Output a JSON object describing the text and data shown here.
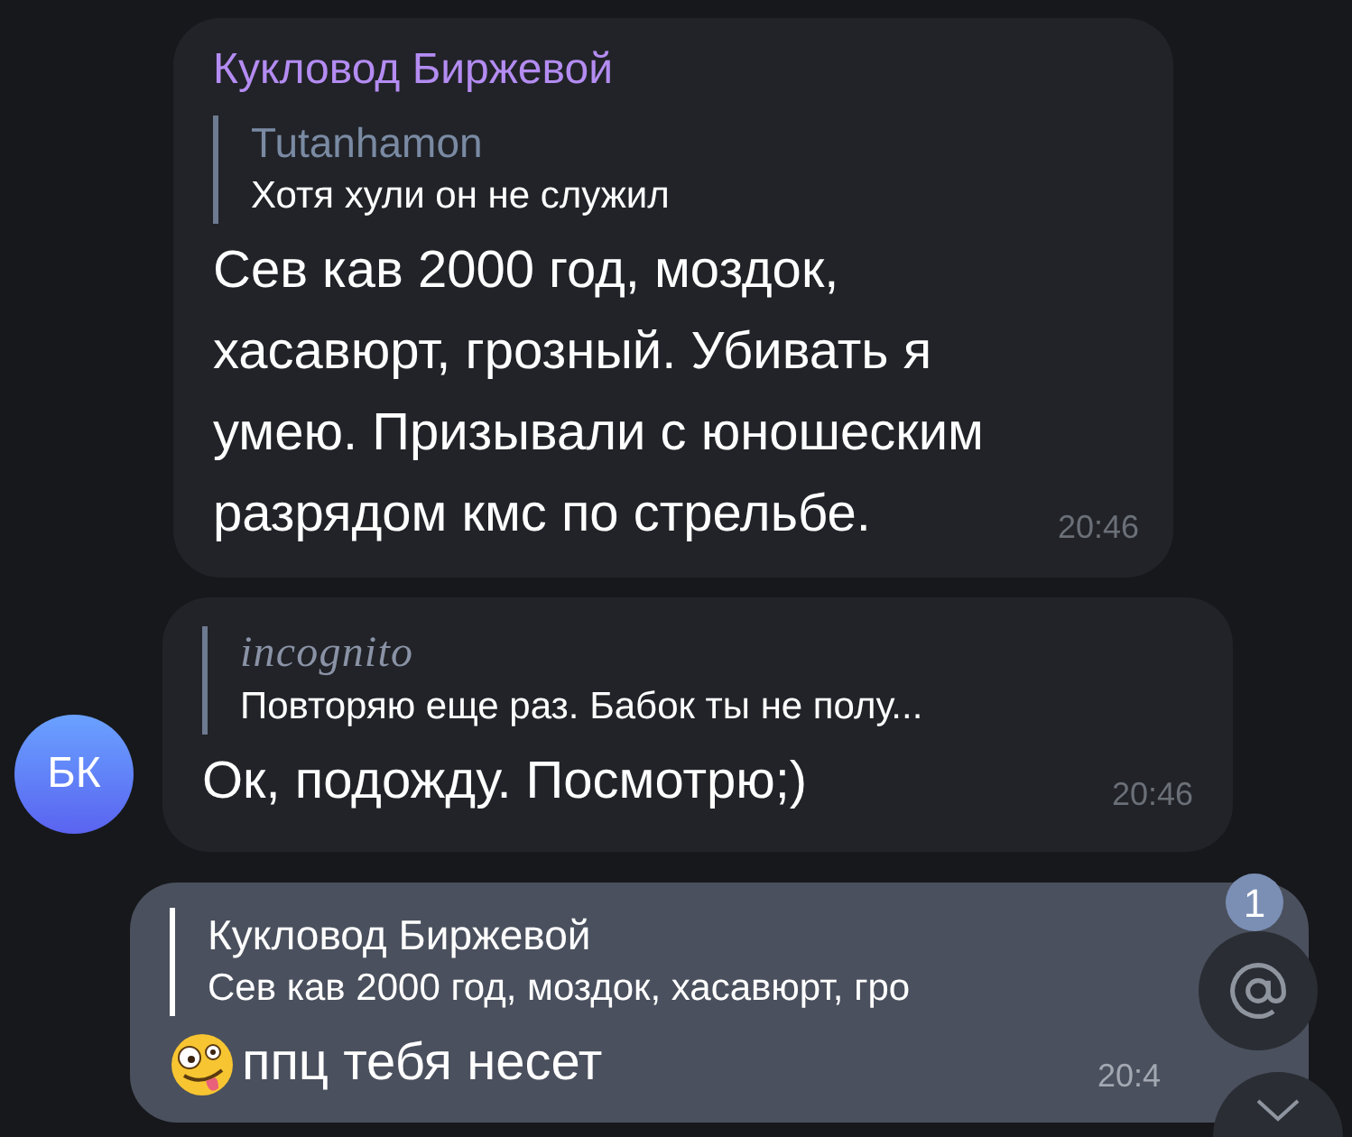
{
  "messages": [
    {
      "kind": "incoming",
      "sender": "Кукловод Биржевой",
      "reply": {
        "author": "Tutanhamon",
        "kind": "plain",
        "text": "Хотя хули он не служил"
      },
      "text": "Сев кав 2000 год, моздок, хасавюрт, грозный. Убивать я умею. Призывали с юношеским разрядом кмс по стрельбе.",
      "time": "20:46"
    },
    {
      "kind": "incoming",
      "avatar": "БК",
      "reply": {
        "author": "incognito",
        "kind": "script",
        "text": "Повторяю еще раз. Бабок ты не полу..."
      },
      "text": "Ок, подожду. Посмотрю;)",
      "time": "20:46"
    },
    {
      "kind": "outgoing",
      "emoji": true,
      "reply": {
        "author": "Кукловод Биржевой",
        "kind": "plain",
        "text": "Сев кав 2000 год, моздок, хасавюрт, гро"
      },
      "text": "ппц тебя несет",
      "time": "20:4"
    }
  ],
  "mention_button": {
    "badge": "1"
  }
}
